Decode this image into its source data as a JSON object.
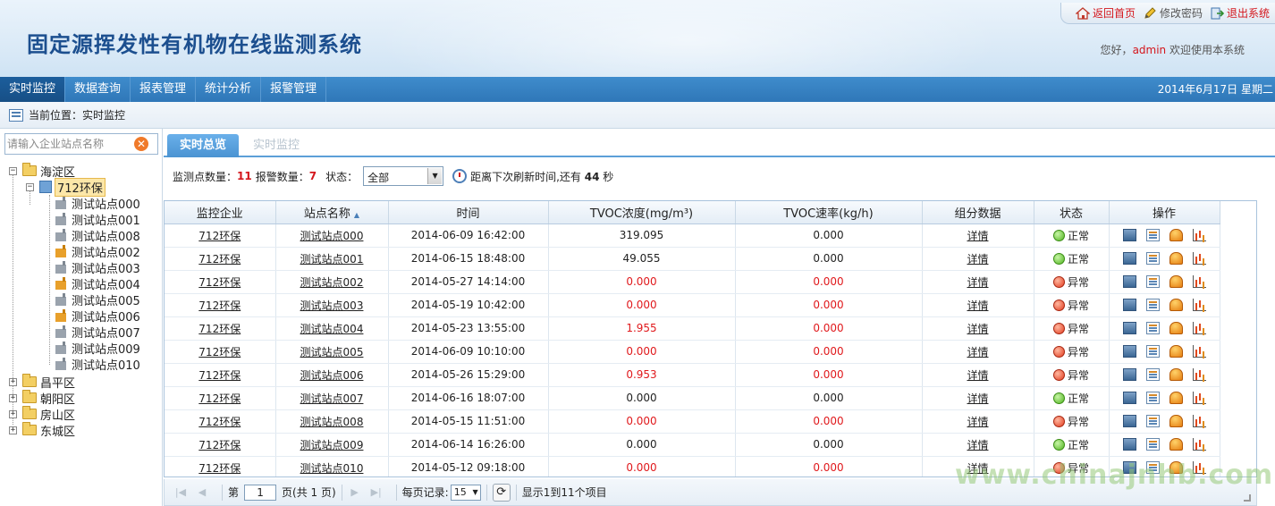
{
  "app": {
    "title": "固定源挥发性有机物在线监测系统"
  },
  "top_links": [
    {
      "label": "返回首页",
      "icon": "home-icon",
      "color": "#d4161c"
    },
    {
      "label": "修改密码",
      "icon": "pencil-icon",
      "color": "#555555"
    },
    {
      "label": "退出系统",
      "icon": "exit-icon",
      "color": "#d4161c"
    }
  ],
  "welcome": {
    "prefix": "您好，",
    "user": "admin",
    "suffix": " 欢迎使用本系统"
  },
  "nav": {
    "items": [
      "实时监控",
      "数据查询",
      "报表管理",
      "统计分析",
      "报警管理"
    ],
    "active": 0,
    "date": "2014年6月17日 星期二"
  },
  "breadcrumb": {
    "label": "当前位置：实时监控"
  },
  "search": {
    "placeholder": "请输入企业站点名称"
  },
  "tree": {
    "root": "海淀区",
    "company": "712环保",
    "stations": [
      {
        "name": "测试站点000",
        "alarm": false
      },
      {
        "name": "测试站点001",
        "alarm": false
      },
      {
        "name": "测试站点008",
        "alarm": false
      },
      {
        "name": "测试站点002",
        "alarm": true
      },
      {
        "name": "测试站点003",
        "alarm": false
      },
      {
        "name": "测试站点004",
        "alarm": true
      },
      {
        "name": "测试站点005",
        "alarm": false
      },
      {
        "name": "测试站点006",
        "alarm": true
      },
      {
        "name": "测试站点007",
        "alarm": false
      },
      {
        "name": "测试站点009",
        "alarm": false
      },
      {
        "name": "测试站点010",
        "alarm": false
      }
    ],
    "districts": [
      "昌平区",
      "朝阳区",
      "房山区",
      "东城区"
    ]
  },
  "tabs": [
    {
      "label": "实时总览",
      "active": true
    },
    {
      "label": "实时监控",
      "active": false
    }
  ],
  "stats": {
    "monitor_label": "监测点数量：",
    "monitor_count": "11",
    "alarm_label": "报警数量：",
    "alarm_count": "7",
    "status_label": "状态：",
    "status_value": "全部",
    "refresh_prefix": "距离下次刷新时间,还有 ",
    "refresh_seconds": "44",
    "refresh_suffix": " 秒"
  },
  "table": {
    "columns": [
      "监控企业",
      "站点名称",
      "时间",
      "TVOC浓度(mg/m³)",
      "TVOC速率(kg/h)",
      "组分数据",
      "状态",
      "操作"
    ],
    "rows": [
      {
        "company": "712环保",
        "station": "测试站点000",
        "time": "2014-06-09 16:42:00",
        "tvoc": "319.095",
        "rate": "0.000",
        "detail": "详情",
        "status": "正常",
        "ok": true
      },
      {
        "company": "712环保",
        "station": "测试站点001",
        "time": "2014-06-15 18:48:00",
        "tvoc": "49.055",
        "rate": "0.000",
        "detail": "详情",
        "status": "正常",
        "ok": true
      },
      {
        "company": "712环保",
        "station": "测试站点002",
        "time": "2014-05-27 14:14:00",
        "tvoc": "0.000",
        "rate": "0.000",
        "detail": "详情",
        "status": "异常",
        "ok": false
      },
      {
        "company": "712环保",
        "station": "测试站点003",
        "time": "2014-05-19 10:42:00",
        "tvoc": "0.000",
        "rate": "0.000",
        "detail": "详情",
        "status": "异常",
        "ok": false
      },
      {
        "company": "712环保",
        "station": "测试站点004",
        "time": "2014-05-23 13:55:00",
        "tvoc": "1.955",
        "rate": "0.000",
        "detail": "详情",
        "status": "异常",
        "ok": false
      },
      {
        "company": "712环保",
        "station": "测试站点005",
        "time": "2014-06-09 10:10:00",
        "tvoc": "0.000",
        "rate": "0.000",
        "detail": "详情",
        "status": "异常",
        "ok": false
      },
      {
        "company": "712环保",
        "station": "测试站点006",
        "time": "2014-05-26 15:29:00",
        "tvoc": "0.953",
        "rate": "0.000",
        "detail": "详情",
        "status": "异常",
        "ok": false
      },
      {
        "company": "712环保",
        "station": "测试站点007",
        "time": "2014-06-16 18:07:00",
        "tvoc": "0.000",
        "rate": "0.000",
        "detail": "详情",
        "status": "正常",
        "ok": true
      },
      {
        "company": "712环保",
        "station": "测试站点008",
        "time": "2014-05-15 11:51:00",
        "tvoc": "0.000",
        "rate": "0.000",
        "detail": "详情",
        "status": "异常",
        "ok": false
      },
      {
        "company": "712环保",
        "station": "测试站点009",
        "time": "2014-06-14 16:26:00",
        "tvoc": "0.000",
        "rate": "0.000",
        "detail": "详情",
        "status": "正常",
        "ok": true
      },
      {
        "company": "712环保",
        "station": "测试站点010",
        "time": "2014-05-12 09:18:00",
        "tvoc": "0.000",
        "rate": "0.000",
        "detail": "详情",
        "status": "异常",
        "ok": false
      }
    ]
  },
  "pager": {
    "page_label": "第",
    "page_value": "1",
    "total_label": "页(共 1 页)",
    "per_page_label": "每页记录:",
    "per_page_value": "15",
    "summary": "显示1到11个项目"
  },
  "watermark": "www.chinajnhb.com",
  "colors": {
    "accent": "#2f77b8",
    "alarm_text": "#e0191c",
    "title": "#1c4f8f"
  }
}
